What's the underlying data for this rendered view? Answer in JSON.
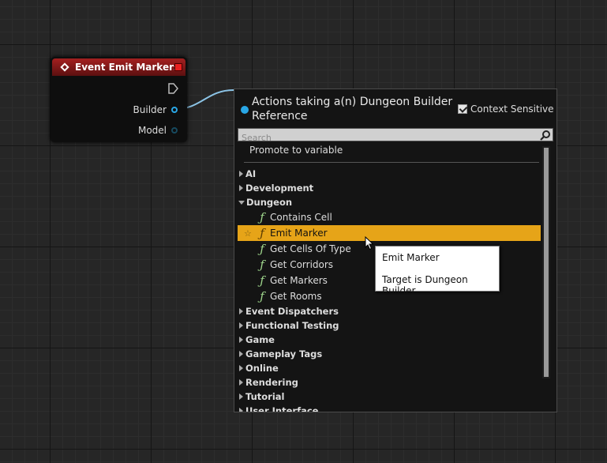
{
  "node": {
    "title": "Event Emit Markers",
    "header_color": "#a42020",
    "pins": [
      {
        "label": "Builder",
        "connected": true
      },
      {
        "label": "Model",
        "connected": false
      }
    ]
  },
  "menu": {
    "title": "Actions taking a(n) Dungeon Builder Reference",
    "context_sensitive_label": "Context Sensitive",
    "context_sensitive_checked": true,
    "search_placeholder": "Search",
    "promote_label": "Promote to variable",
    "categories_top": [
      "AI",
      "Development"
    ],
    "expanded_category": "Dungeon",
    "functions": [
      "Contains Cell",
      "Emit Marker",
      "Get Cells Of Type",
      "Get Corridors",
      "Get Markers",
      "Get Rooms"
    ],
    "selected_function": "Emit Marker",
    "categories_bottom": [
      "Event Dispatchers",
      "Functional Testing",
      "Game",
      "Gameplay Tags",
      "Online",
      "Rendering",
      "Tutorial",
      "User Interface"
    ],
    "highlight_color": "#e6a418"
  },
  "tooltip": {
    "line1": "Emit Marker",
    "line2": "Target is Dungeon Builder"
  },
  "icons": {
    "pin": "pin-icon",
    "function": "function-icon",
    "search": "search-icon",
    "favorite": "star-icon"
  }
}
